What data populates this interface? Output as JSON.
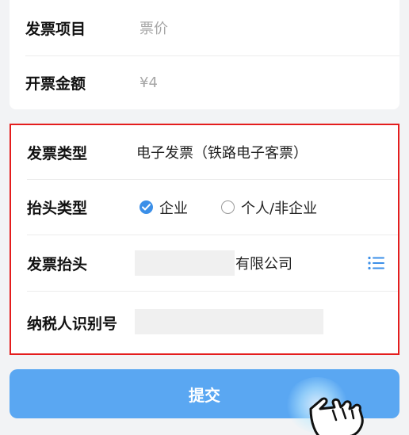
{
  "summary": {
    "item_label": "发票项目",
    "item_value": "票价",
    "amount_label": "开票金额",
    "amount_value": "¥4"
  },
  "form": {
    "type_label": "发票类型",
    "type_value": "电子发票（铁路电子客票）",
    "title_type_label": "抬头类型",
    "title_type_options": [
      "企业",
      "个人/非企业"
    ],
    "title_type_selected": "企业",
    "title_label": "发票抬头",
    "title_value_suffix": "有限公司",
    "tax_id_label": "纳税人识别号",
    "tax_id_value": ""
  },
  "actions": {
    "submit_label": "提交"
  },
  "colors": {
    "accent": "#3b8fe8",
    "button": "#5aa7f2",
    "highlight_border": "#e41d1d"
  },
  "icons": {
    "checked_radio": "check-circle-icon",
    "unchecked_radio": "circle-icon",
    "title_picker": "list-icon",
    "pointer": "hand-pointer-icon"
  }
}
